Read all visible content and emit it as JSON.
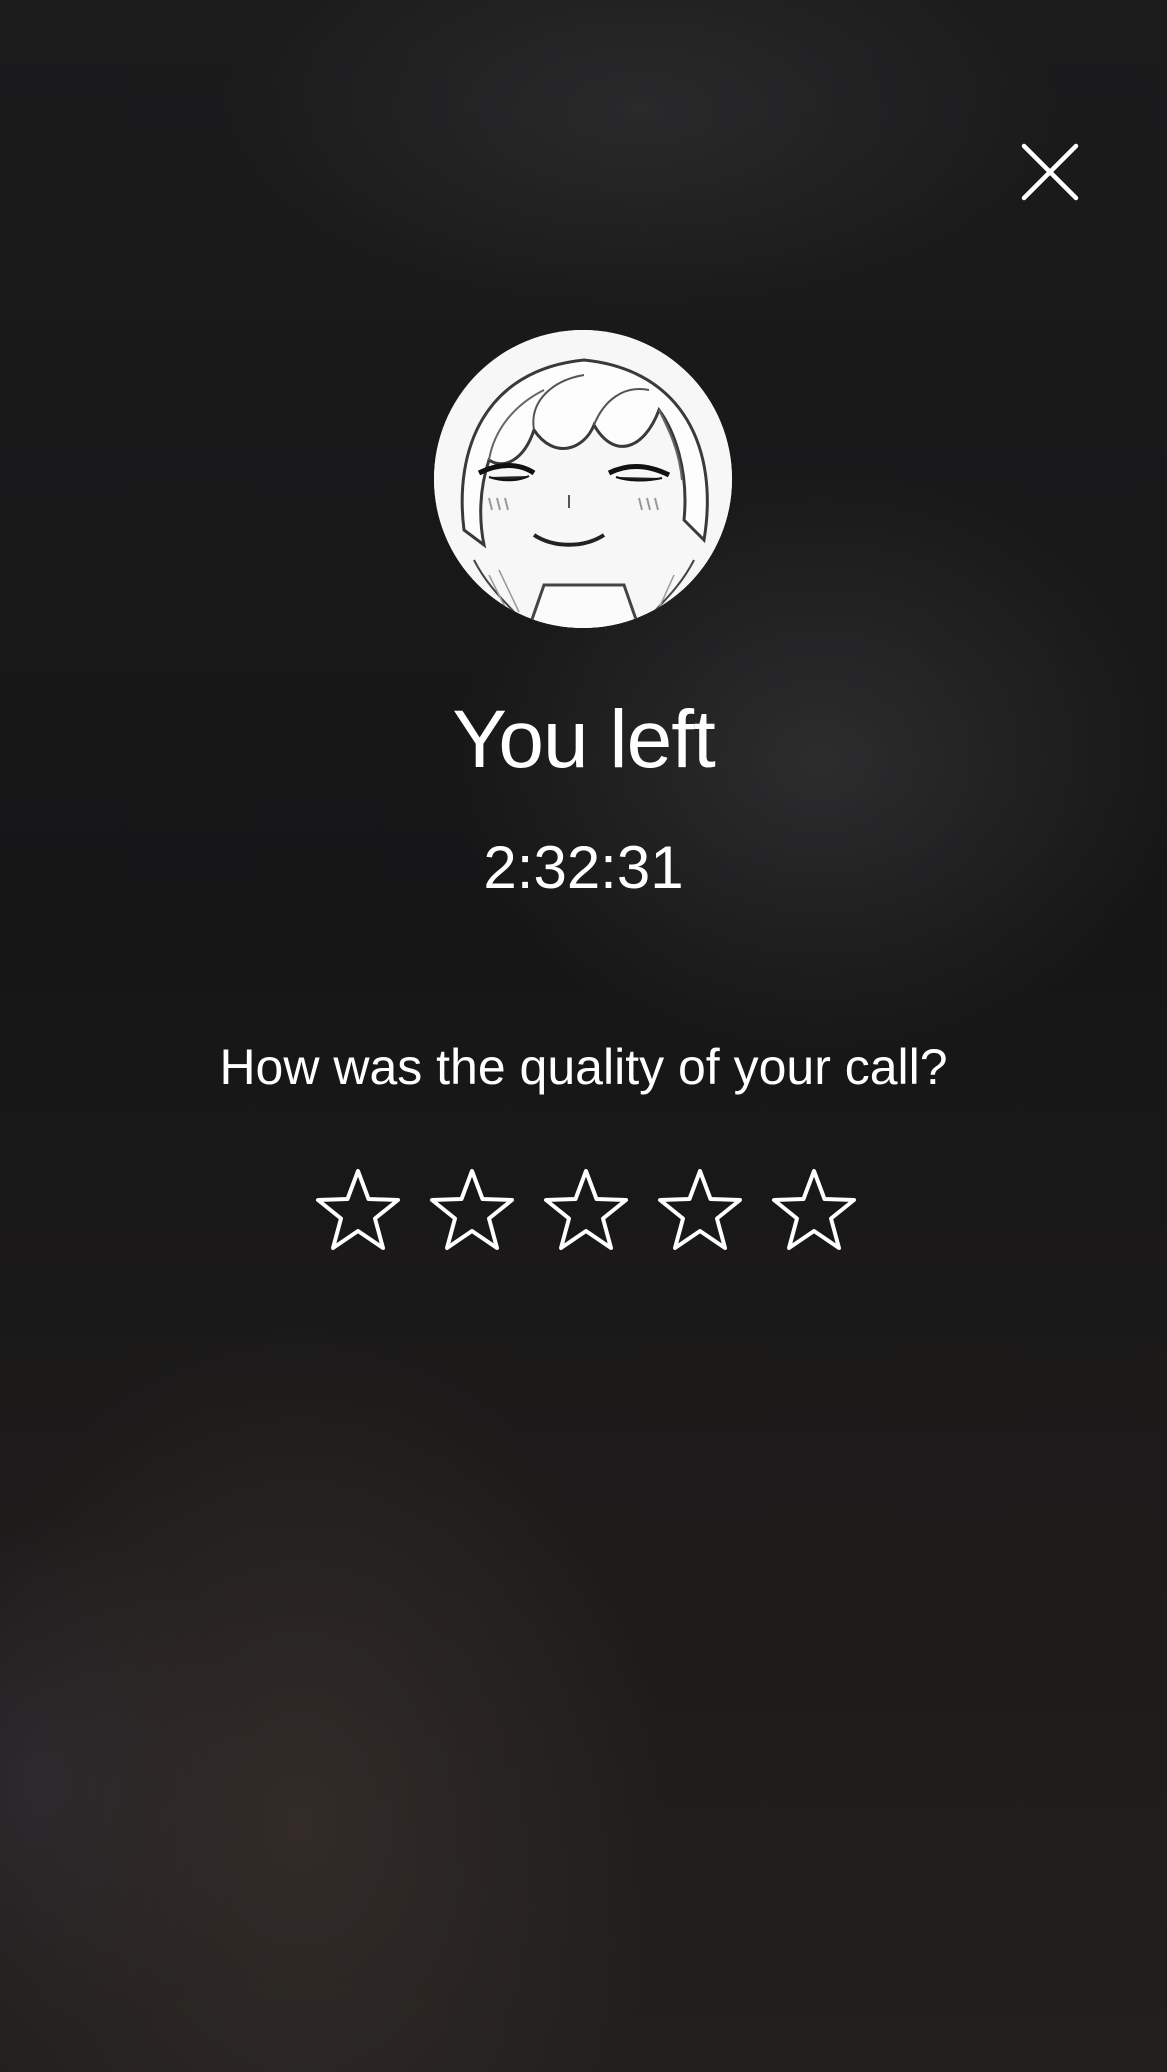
{
  "call_ended": {
    "title": "You left",
    "duration": "2:32:31",
    "rating_prompt": "How was the quality of your call?",
    "rating": {
      "max_stars": 5,
      "selected": 0
    }
  },
  "icons": {
    "close": "close-icon",
    "star": "star-outline-icon",
    "avatar": "manga-girl-avatar"
  },
  "colors": {
    "text": "#ffffff",
    "background": "#151516",
    "star_outline": "#ffffff"
  }
}
